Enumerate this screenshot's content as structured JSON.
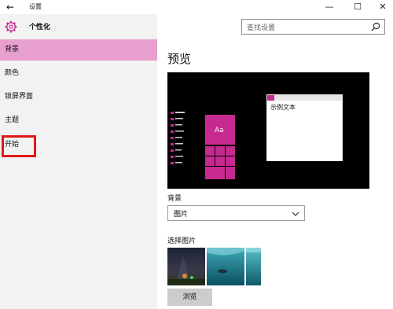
{
  "window": {
    "title": "设置",
    "back_icon": "back-arrow-icon",
    "minimize_glyph": "—",
    "maximize_glyph": "☐",
    "close_glyph": "✕"
  },
  "header": {
    "title": "个性化",
    "icon": "gear-icon"
  },
  "search": {
    "placeholder": "查找设置"
  },
  "sidebar": {
    "items": [
      {
        "label": "背景",
        "active": true
      },
      {
        "label": "颜色",
        "active": false
      },
      {
        "label": "锁屏界面",
        "active": false
      },
      {
        "label": "主题",
        "active": false
      },
      {
        "label": "开始",
        "active": false,
        "highlighted": true
      }
    ]
  },
  "main": {
    "title": "预览",
    "preview": {
      "tile_label": "Aa",
      "sample_text": "示例文本"
    },
    "background_label": "背景",
    "background_value": "图片",
    "choose_picture_label": "选择图片",
    "browse_label": "浏览"
  },
  "colors": {
    "accent": "#c72a8f",
    "active_nav": "#e8a1cf",
    "sidebar_bg": "#f2f2f2",
    "callout_red": "#e01818"
  }
}
